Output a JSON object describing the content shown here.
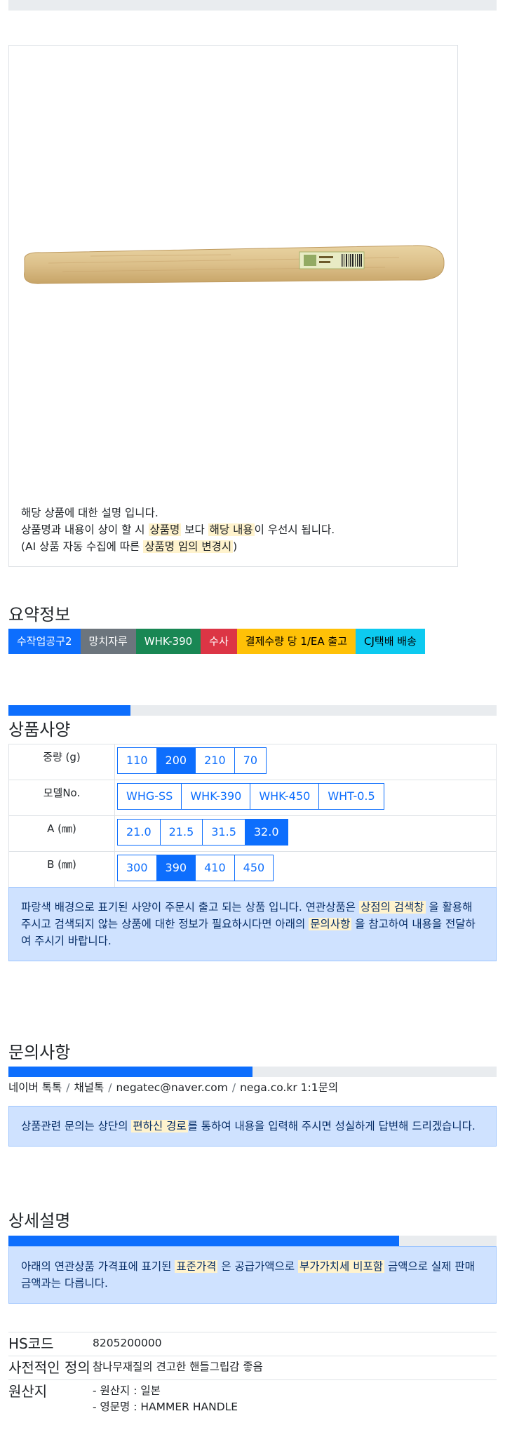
{
  "image_card": {
    "image_alt": "hammer-handle-product-photo",
    "caption_line1": "해당 상품에 대한 설명 입니다.",
    "caption_line2_a": "상품명과 내용이 상이 할 시 ",
    "caption_line2_hl1": "상품명",
    "caption_line2_b": " 보다 ",
    "caption_line2_hl2": "해당 내용",
    "caption_line2_c": "이 우선시 됩니다.",
    "caption_line3_a": "(AI 상품 자동 수집에 따른 ",
    "caption_line3_hl": "상품명 임의 변경시",
    "caption_line3_b": ")"
  },
  "summary": {
    "title": "요약정보",
    "badges": [
      {
        "label": "수작업공구2",
        "bg": "#0d6efd",
        "color": "#ffffff"
      },
      {
        "label": "망치자루",
        "bg": "#6c757d",
        "color": "#ffffff"
      },
      {
        "label": "WHK-390",
        "bg": "#198754",
        "color": "#ffffff"
      },
      {
        "label": "수사",
        "bg": "#dc3545",
        "color": "#ffffff"
      },
      {
        "label": "결제수량 당 1/EA 출고",
        "bg": "#ffc107",
        "color": "#000000"
      },
      {
        "label": "CJ택배 배송",
        "bg": "#0dcaf0",
        "color": "#000000"
      }
    ]
  },
  "specs": {
    "progress": 0.25,
    "title": "상품사양",
    "rows": [
      {
        "label": "중량 (g)",
        "options": [
          "110",
          "200",
          "210",
          "70"
        ],
        "selected": "200"
      },
      {
        "label": "모델No.",
        "options": [
          "WHG-SS",
          "WHK-390",
          "WHK-450",
          "WHT-0.5"
        ],
        "selected": ""
      },
      {
        "label": "A (㎜)",
        "options": [
          "21.0",
          "21.5",
          "31.5",
          "32.0"
        ],
        "selected": "32.0"
      },
      {
        "label": "B (㎜)",
        "options": [
          "300",
          "390",
          "410",
          "450"
        ],
        "selected": "390"
      }
    ],
    "notice_a": "파랑색 배경으로 표기된 사양이 주문시 출고 되는 상품 입니다. 연관상품은 ",
    "notice_hl1": "상점의 검색창",
    "notice_b": " 을 활용해 주시고 검색되지 않는 상품에 대한 정보가 필요하시다면 아래의 ",
    "notice_hl2": "문의사항",
    "notice_c": " 을 참고하여 내용을 전달하여 주시기 바랍니다."
  },
  "inquiry": {
    "title": "문의사항",
    "progress": 0.5,
    "contacts": [
      "네이버 톡톡",
      "채널톡",
      "negatec@naver.com",
      "nega.co.kr 1:1문의"
    ],
    "separator": "/",
    "notice_a": "상품관련 문의는 상단의 ",
    "notice_hl": "편하신 경로",
    "notice_b": "를 통하여 내용을 입력해 주시면 성실하게 답변해 드리겠습니다."
  },
  "detail": {
    "title": "상세설명",
    "progress": 0.8,
    "notice_a": "아래의 연관상품 가격표에 표기된 ",
    "notice_hl1": "표준가격",
    "notice_b": " 은 공급가액으로 ",
    "notice_hl2": "부가가치세 비포함",
    "notice_c": " 금액으로 실제 판매금액과는 다릅니다.",
    "info": [
      {
        "key": "HS코드",
        "value": "8205200000"
      },
      {
        "key": "사전적인 정의",
        "value": "참나무재질의 견고한 핸들그립감 좋음"
      },
      {
        "key": "원산지",
        "value_lines": [
          "- 원산지 : 일본",
          "- 영문명 : HAMMER HANDLE"
        ]
      }
    ]
  }
}
